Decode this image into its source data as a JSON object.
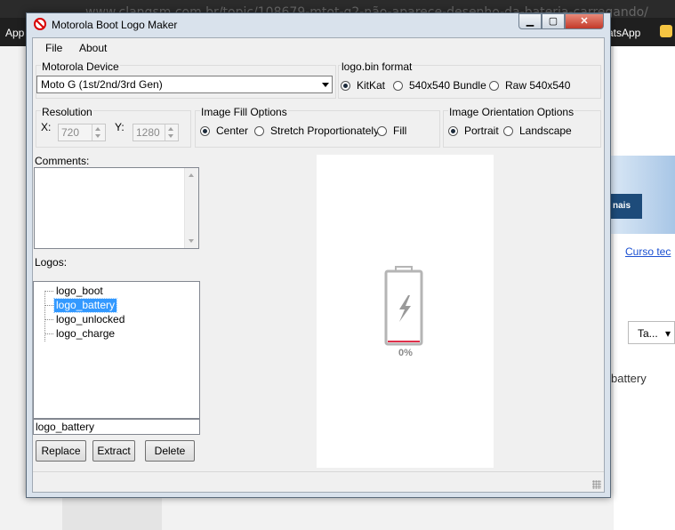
{
  "browser": {
    "url": "www.clangsm.com.br/topic/108679-mtot-g2-não-aparece-desenho-da-bateria-carregando/",
    "apps_label": "App",
    "whatsapp_label": "atsApp",
    "hero_button": "nais",
    "link_text": "Curso tec",
    "tab_button": "Ta...",
    "battery_text": "battery"
  },
  "window": {
    "title": "Motorola Boot Logo Maker",
    "min_symbol": "▁",
    "max_symbol": "▢",
    "close_symbol": "✕"
  },
  "menu": {
    "file": "File",
    "about": "About"
  },
  "device": {
    "label": "Motorola Device",
    "selected": "Moto G (1st/2nd/3rd Gen)"
  },
  "format": {
    "label": "logo.bin format",
    "options": [
      "KitKat",
      "540x540 Bundle",
      "Raw 540x540"
    ],
    "selected_index": 0
  },
  "resolution": {
    "label": "Resolution",
    "x_label": "X:",
    "x_value": "720",
    "y_label": "Y:",
    "y_value": "1280"
  },
  "fill": {
    "label": "Image Fill Options",
    "options": [
      "Center",
      "Stretch Proportionately",
      "Fill"
    ],
    "selected_index": 0
  },
  "orientation": {
    "label": "Image Orientation Options",
    "options": [
      "Portrait",
      "Landscape"
    ],
    "selected_index": 0
  },
  "comments": {
    "label": "Comments:",
    "value": ""
  },
  "logos": {
    "label": "Logos:",
    "items": [
      "logo_boot",
      "logo_battery",
      "logo_unlocked",
      "logo_charge"
    ],
    "selected_index": 1,
    "name_value": "logo_battery"
  },
  "buttons": {
    "replace": "Replace",
    "extract": "Extract",
    "delete": "Delete"
  },
  "preview": {
    "percent_label": "0%",
    "battery_fill_percent": 0,
    "accent_color": "#e0304a"
  }
}
